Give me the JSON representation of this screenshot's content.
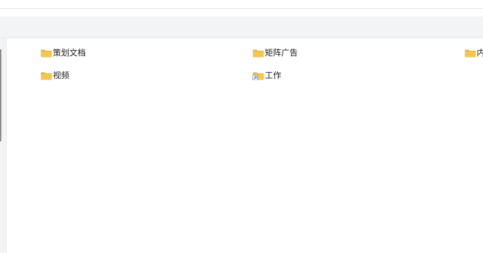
{
  "folders": [
    {
      "name": "策划文档",
      "shortcut": false
    },
    {
      "name": "矩阵广告",
      "shortcut": false
    },
    {
      "name": "内",
      "shortcut": false
    },
    {
      "name": "视频",
      "shortcut": false
    },
    {
      "name": "工作",
      "shortcut": true
    }
  ],
  "colors": {
    "folder_body": "#f3c552",
    "folder_tab": "#e7b33c",
    "toolbar_bg": "#f3f4f5",
    "nav_bg": "#f3f3f3"
  }
}
